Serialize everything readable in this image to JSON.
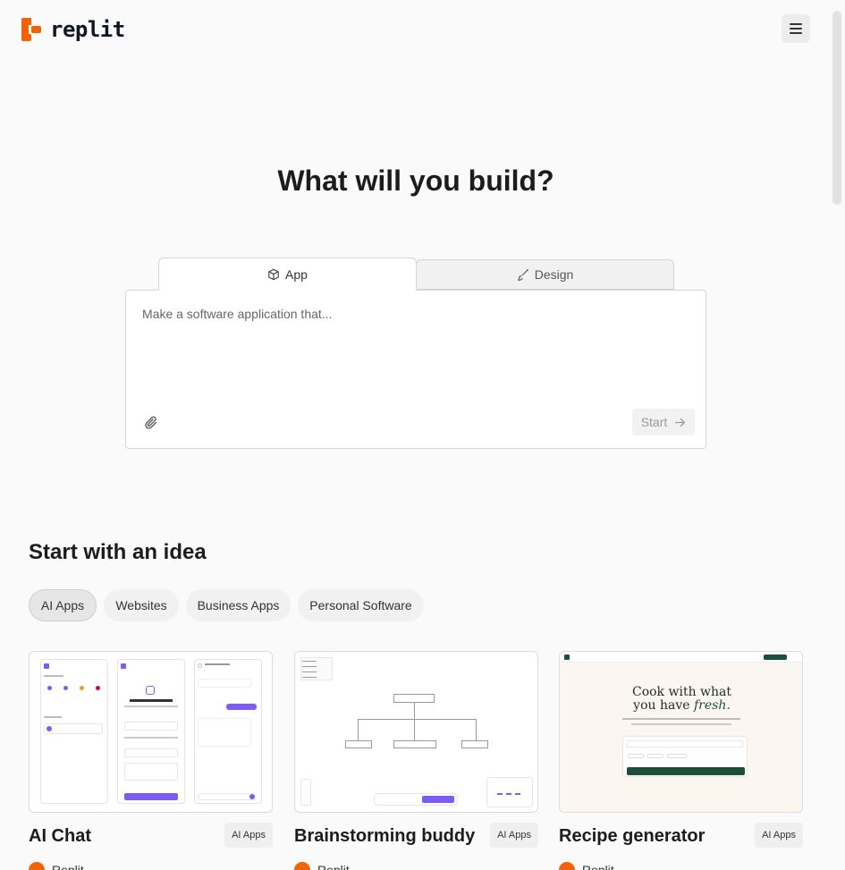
{
  "header": {
    "logo_text": "replit",
    "menu_icon": "hamburger-menu-icon"
  },
  "hero": {
    "title": "What will you build?",
    "tabs": [
      {
        "label": "App",
        "icon": "cube-icon",
        "selected": true
      },
      {
        "label": "Design",
        "icon": "brush-icon",
        "selected": false
      }
    ],
    "prompt": {
      "placeholder": "Make a software application that...",
      "value": "",
      "attach_icon": "paperclip-icon",
      "start_label": "Start",
      "start_icon": "arrow-right-icon"
    }
  },
  "ideas": {
    "title": "Start with an idea",
    "filters": [
      {
        "label": "AI Apps",
        "active": true
      },
      {
        "label": "Websites",
        "active": false
      },
      {
        "label": "Business Apps",
        "active": false
      },
      {
        "label": "Personal Software",
        "active": false
      }
    ],
    "cards": [
      {
        "title": "AI Chat",
        "tag": "AI Apps",
        "author": "Replit"
      },
      {
        "title": "Brainstorming buddy",
        "tag": "AI Apps",
        "author": "Replit"
      },
      {
        "title": "Recipe generator",
        "tag": "AI Apps",
        "author": "Replit"
      }
    ],
    "card_previews": {
      "recipe_headline_1": "Cook with what",
      "recipe_headline_2": "you have",
      "recipe_headline_em": "fresh."
    }
  },
  "colors": {
    "brand": "#f26207",
    "background": "#fafafa",
    "accent_purple": "#7c5cf5",
    "recipe_green": "#1e4d3a"
  }
}
